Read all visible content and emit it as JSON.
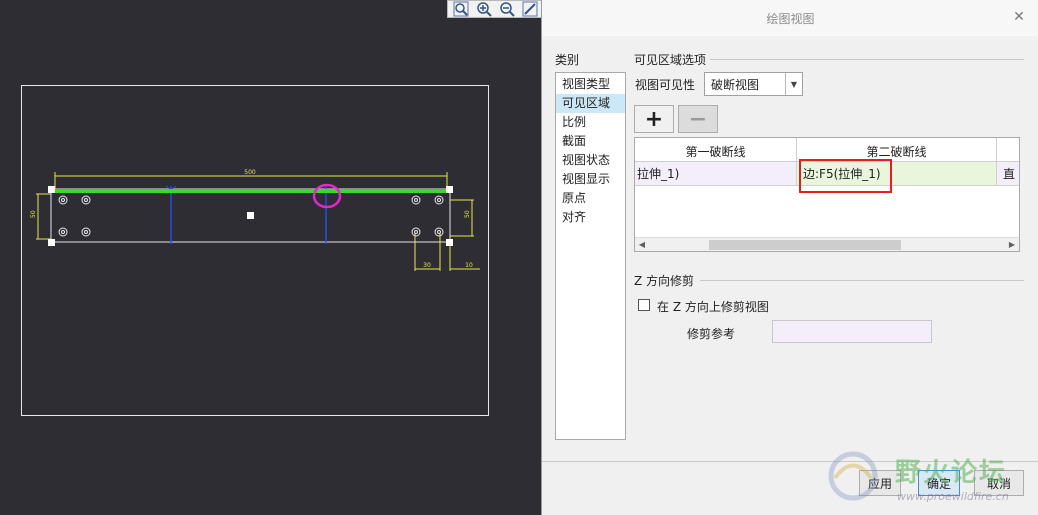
{
  "toolbar": {
    "icons": [
      "zoom-fit-icon",
      "zoom-in-icon",
      "zoom-out-icon",
      "pan-icon"
    ]
  },
  "drawing": {
    "dim_top": "500",
    "dim_left": "50",
    "dim_right": "50",
    "dim_bottom_a": "30",
    "dim_bottom_b": "10",
    "colors": {
      "sheet_border": "#e8e8e8",
      "part_outline": "#e8e8e8",
      "break_edge": "#33dd22",
      "break_lines": "#2050e0",
      "marker_circle": "#e02ad0",
      "dimensions": "#e8e84a"
    }
  },
  "dialog": {
    "title": "绘图视图",
    "close_icon": "close-icon",
    "category_label": "类别",
    "categories": [
      {
        "label": "视图类型",
        "active": false
      },
      {
        "label": "可见区域",
        "active": true
      },
      {
        "label": "比例",
        "active": false
      },
      {
        "label": "截面",
        "active": false
      },
      {
        "label": "视图状态",
        "active": false
      },
      {
        "label": "视图显示",
        "active": false
      },
      {
        "label": "原点",
        "active": false
      },
      {
        "label": "对齐",
        "active": false
      }
    ],
    "visible_area_options": "可见区域选项",
    "view_visibility_label": "视图可见性",
    "view_visibility_value": "破断视图",
    "add_icon": "plus-icon",
    "remove_icon": "minus-icon",
    "table": {
      "headers": [
        "第一破断线",
        "第二破断线"
      ],
      "row": [
        "拉伸_1)",
        "边:F5(拉伸_1)",
        "直"
      ]
    },
    "z_trim_title": "Z 方向修剪",
    "z_trim_checkbox_label": "在 Z 方向上修剪视图",
    "trim_ref_label": "修剪参考",
    "trim_ref_value": "",
    "buttons": {
      "apply": "应用",
      "ok": "确定",
      "cancel": "取消"
    }
  },
  "watermark": {
    "text": "野火论坛",
    "url": "www.proewildfire.cn"
  }
}
